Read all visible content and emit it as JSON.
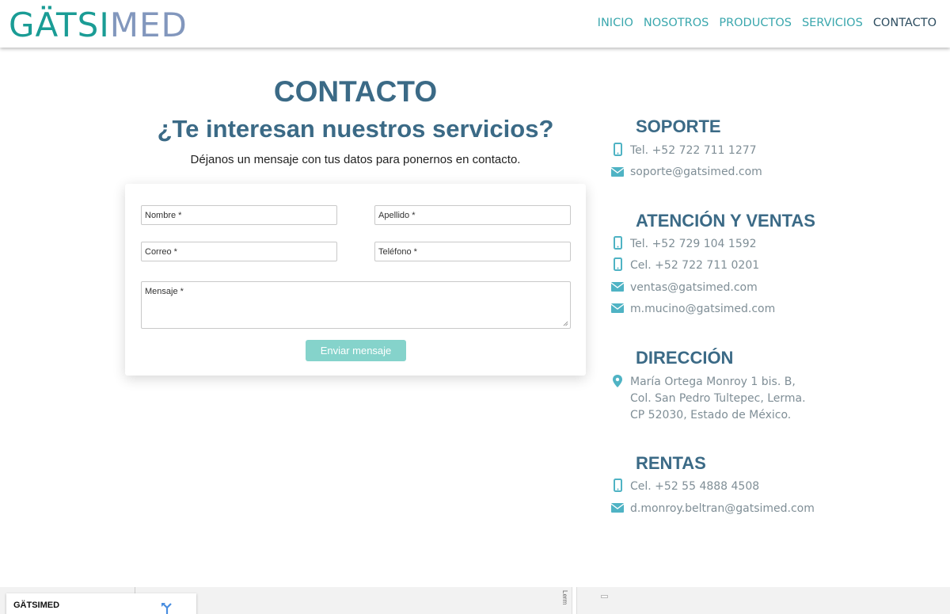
{
  "header": {
    "logo_part1": "GÄTSI",
    "logo_part2": "MED",
    "nav": [
      "INICIO",
      "NOSOTROS",
      "PRODUCTOS",
      "SERVICIOS",
      "CONTACTO"
    ]
  },
  "main": {
    "title": "CONTACTO",
    "subtitle": "¿Te interesan nuestros servicios?",
    "intro": "Déjanos un mensaje con tus datos para ponernos en contacto."
  },
  "form": {
    "nombre": "Nombre *",
    "apellido": "Apellido *",
    "correo": "Correo *",
    "telefono": "Teléfono *",
    "mensaje": "Mensaje *",
    "submit": "Enviar mensaje"
  },
  "contact": {
    "soporte": {
      "heading": "SOPORTE",
      "tel": "Tel. +52 722 711 1277",
      "email": "soporte@gatsimed.com"
    },
    "ventas": {
      "heading": "ATENCIÓN Y VENTAS",
      "tel": "Tel. +52 729 104 1592",
      "cel": "Cel. +52 722 711 0201",
      "email1": "ventas@gatsimed.com",
      "email2": "m.mucino@gatsimed.com"
    },
    "direccion": {
      "heading": "DIRECCIÓN",
      "line1": "María Ortega Monroy 1 bis. B,",
      "line2": "Col. San Pedro Tultepec, Lerma.",
      "line3": "CP 52030, Estado de México."
    },
    "rentas": {
      "heading": "RENTAS",
      "cel": "Cel. +52 55 4888 4508",
      "email": "d.monroy.beltran@gatsimed.com"
    }
  },
  "map": {
    "card_title": "GÄTSIMED",
    "road_label": "Lerm"
  },
  "colors": {
    "accent": "#3aa7ad",
    "heading": "#3b6a86",
    "button": "#85d3cb",
    "icon": "#4fb3c4"
  },
  "icons": {
    "phone": "phone-icon",
    "email": "envelope-icon",
    "location": "map-pin-icon"
  }
}
